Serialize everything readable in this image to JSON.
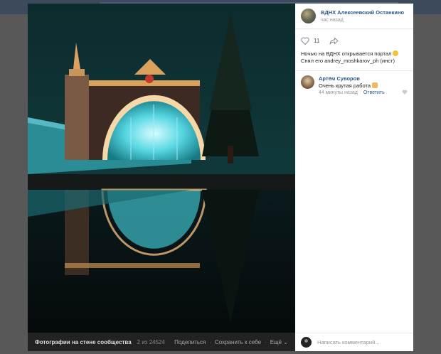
{
  "post": {
    "group_name": "ВДНХ Алексеевский Останкино",
    "time": "час назад",
    "likes": "11",
    "text_line1": "Ночью на ВДНХ открывается портал",
    "text_line2": "Снял его andrey_moshkarov_ph (инст)"
  },
  "comment": {
    "author": "Артём Суворов",
    "text": "Очень крутая работа",
    "time": "44 минуты назад",
    "reply": "Ответить"
  },
  "footer": {
    "title": "Фотографии на стене сообщества",
    "count": "2 из 24524",
    "share": "Поделиться",
    "save": "Сохранить к себе",
    "more": "Ещё"
  },
  "comment_box": {
    "placeholder": "Написать комментарий..."
  },
  "icons": {
    "like": "heart-icon",
    "share": "share-arrow-icon",
    "more": "chevron-down-icon"
  },
  "colors": {
    "link": "#2a5885",
    "muted": "#939393",
    "background": "#585858"
  }
}
